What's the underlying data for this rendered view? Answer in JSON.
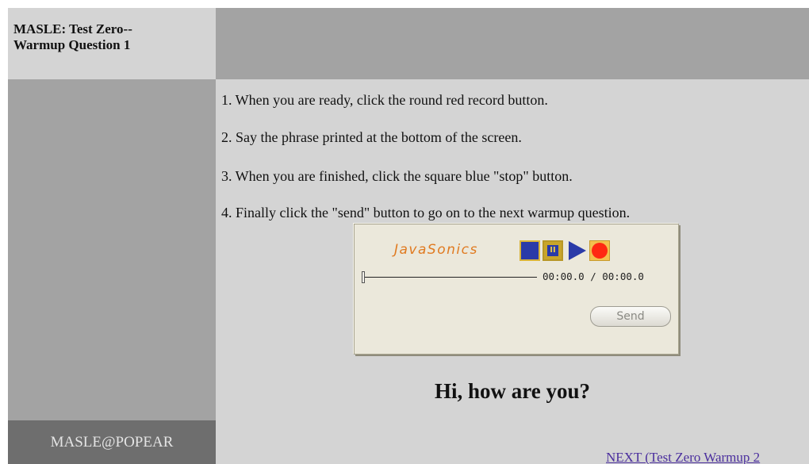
{
  "header": {
    "title_line1": "MASLE: Test Zero--",
    "title_line2": "Warmup Question 1"
  },
  "instructions": [
    "1. When you are ready, click the round red record button.",
    "2. Say the phrase printed at the bottom of the screen.",
    "3. When you are finished, click the square blue \"stop\" button.",
    "4. Finally click the \"send\" button to go on to the next warmup question."
  ],
  "recorder": {
    "brand": "JavaSonics",
    "time_display": "00:00.0 / 00:00.0",
    "send_label": "Send",
    "controls": {
      "stop": "stop-icon",
      "pause": "pause-icon",
      "play": "play-icon",
      "record": "record-icon"
    },
    "colors": {
      "brand": "#e07a20",
      "button_blue": "#2a3aa8",
      "button_gold": "#c9a52a",
      "record_red": "#ff2a12"
    }
  },
  "phrase": "Hi, how are you?",
  "footer": {
    "site": "MASLE@POPEAR",
    "next_link": "NEXT (Test Zero Warmup 2"
  }
}
